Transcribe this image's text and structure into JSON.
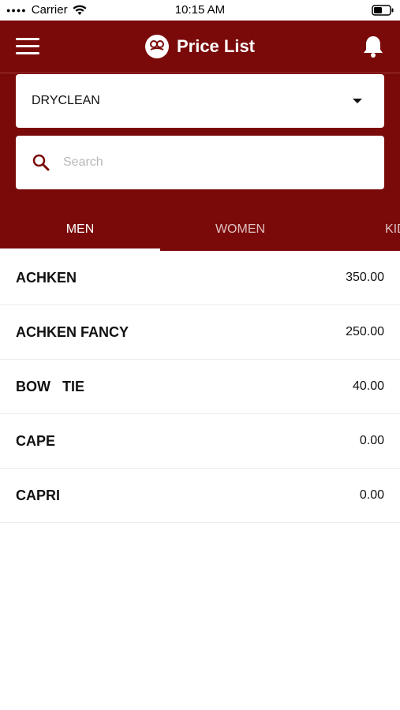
{
  "status_bar": {
    "carrier": "Carrier",
    "time": "10:15 AM"
  },
  "header": {
    "title": "Price List",
    "background_color": "#7a0a0a"
  },
  "service_dropdown": {
    "selected": "DRYCLEAN"
  },
  "search": {
    "placeholder": "Search"
  },
  "tabs": [
    {
      "label": "MEN",
      "active": true
    },
    {
      "label": "WOMEN",
      "active": false
    },
    {
      "label": "KIDS",
      "active": false
    }
  ],
  "items": [
    {
      "name": "ACHKEN",
      "price": "350.00"
    },
    {
      "name": "ACHKEN FANCY",
      "price": "250.00"
    },
    {
      "name": "BOW   TIE",
      "price": "40.00"
    },
    {
      "name": "CAPE",
      "price": "0.00"
    },
    {
      "name": "CAPRI",
      "price": "0.00"
    }
  ]
}
